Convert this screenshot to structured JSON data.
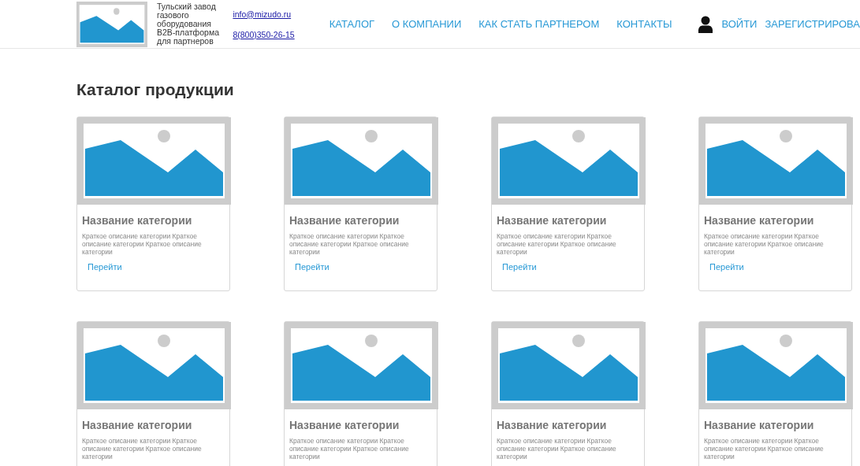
{
  "header": {
    "company": [
      "Тульский завод газового оборудования",
      "B2B-платформа для партнеров"
    ],
    "email": "info@mizudo.ru",
    "phone": "8(800)350-26-15",
    "nav": [
      "КАТАЛОГ",
      "О КОМПАНИИ",
      "КАК СТАТЬ ПАРТНЕРОМ",
      "КОНТАКТЫ"
    ],
    "login": "ВОЙТИ",
    "register": "ЗАРЕГИСТРИРОВА"
  },
  "page_title": "Каталог продукции",
  "cards": [
    {
      "title": "Название категории",
      "description": "Краткое описание категории Краткое описание категории Краткое описание категории",
      "link": "Перейти"
    },
    {
      "title": "Название категории",
      "description": "Краткое описание категории Краткое описание категории Краткое описание категории",
      "link": "Перейти"
    },
    {
      "title": "Название категории",
      "description": "Краткое описание категории Краткое описание категории Краткое описание категории",
      "link": "Перейти"
    },
    {
      "title": "Название категории",
      "description": "Краткое описание категории Краткое описание категории Краткое описание категории",
      "link": "Перейти"
    },
    {
      "title": "Название категории",
      "description": "Краткое описание категории Краткое описание категории Краткое описание категории"
    },
    {
      "title": "Название категории",
      "description": "Краткое описание категории Краткое описание категории Краткое описание категории"
    },
    {
      "title": "Название категории",
      "description": "Краткое описание категории Краткое описание категории Краткое описание категории"
    },
    {
      "title": "Название категории",
      "description": "Краткое описание категории Краткое описание категории Краткое описание категории"
    }
  ]
}
